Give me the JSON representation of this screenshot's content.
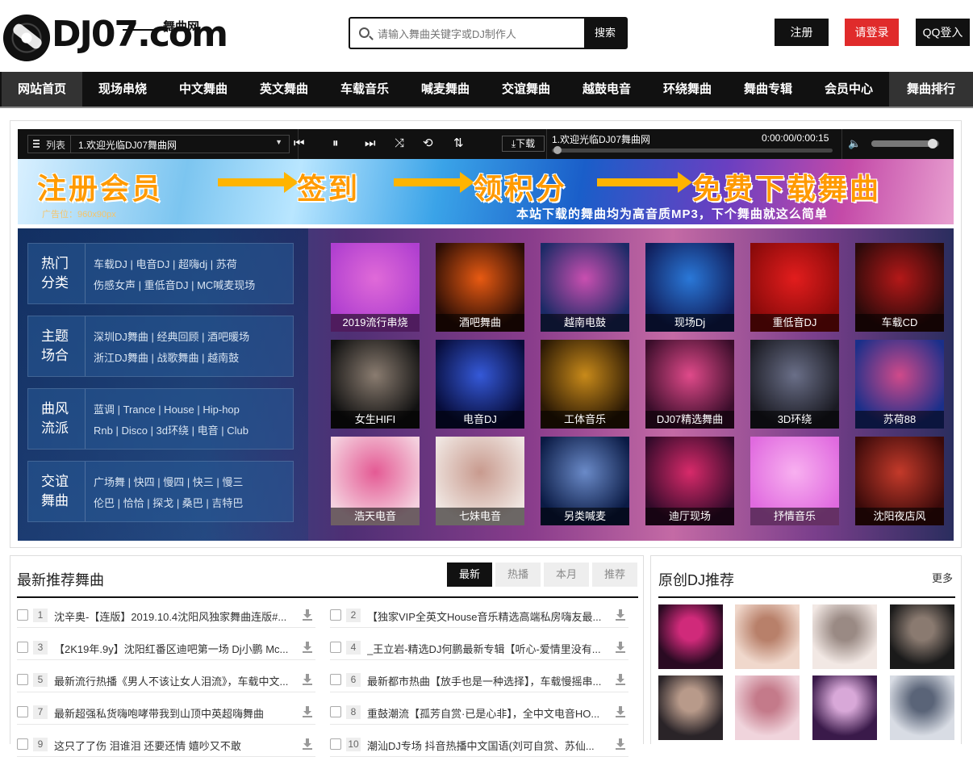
{
  "header": {
    "logo_brand": "DJ07.com",
    "logo_tag": "舞曲网",
    "search_placeholder": "请输入舞曲关键字或DJ制作人",
    "search_button": "搜索",
    "register": "注册",
    "login": "请登录",
    "qq_login": "QQ登入"
  },
  "nav": [
    "网站首页",
    "现场串烧",
    "中文舞曲",
    "英文舞曲",
    "车载音乐",
    "喊麦舞曲",
    "交谊舞曲",
    "越鼓电音",
    "环绕舞曲",
    "舞曲专辑",
    "会员中心",
    "舞曲排行"
  ],
  "player": {
    "list_label": "列表",
    "current_list_track": "1.欢迎光临DJ07舞曲网",
    "download_label": "下载",
    "now_playing": "1.欢迎光临DJ07舞曲网",
    "time": "0:00:00/0:00:15",
    "volume": 0.9,
    "progress": 0.0
  },
  "banner": {
    "step1": "注册会员",
    "step2": "签到",
    "step3": "领积分",
    "step4": "免费下载舞曲",
    "ad_label": "广告位：960x90px",
    "subtitle": "本站下载的舞曲均为高音质MP3，下个舞曲就这么简单"
  },
  "categories": [
    {
      "title": "热门分类",
      "line1": "车载DJ | 电音DJ | 超嗨dj | 苏荷",
      "line2": "伤感女声 | 重低音DJ | MC喊麦现场"
    },
    {
      "title": "主题场合",
      "line1": "深圳DJ舞曲 | 经典回顾 | 酒吧暖场",
      "line2": "浙江DJ舞曲 | 战歌舞曲 | 越南鼓"
    },
    {
      "title": "曲风流派",
      "line1": "蓝调 | Trance | House | Hip-hop",
      "line2": "Rnb | Disco | 3d环绕 | 电音 | Club"
    },
    {
      "title": "交谊舞曲",
      "line1": "广场舞 | 快四 | 慢四 | 快三 | 慢三",
      "line2": "伦巴 | 恰恰 | 探戈 | 桑巴 | 吉特巴"
    }
  ],
  "tiles": [
    {
      "label": "2019流行串烧",
      "c1": "#b03fd0",
      "c2": "#e06ad8"
    },
    {
      "label": "酒吧舞曲",
      "c1": "#2a0d05",
      "c2": "#e85a12"
    },
    {
      "label": "越南电鼓",
      "c1": "#1b2a66",
      "c2": "#c94fb0"
    },
    {
      "label": "现场Dj",
      "c1": "#101d5a",
      "c2": "#2a78d8"
    },
    {
      "label": "重低音DJ",
      "c1": "#8a0a0a",
      "c2": "#e21d1d"
    },
    {
      "label": "车载CD",
      "c1": "#2a0a0a",
      "c2": "#b41818"
    },
    {
      "label": "女生HIFI",
      "c1": "#111111",
      "c2": "#8a7c70"
    },
    {
      "label": "电音DJ",
      "c1": "#070c3a",
      "c2": "#3559d8"
    },
    {
      "label": "工体音乐",
      "c1": "#2a1804",
      "c2": "#c88a1a"
    },
    {
      "label": "DJ07精选舞曲",
      "c1": "#3a0d2a",
      "c2": "#e04a8a"
    },
    {
      "label": "3D环绕",
      "c1": "#1a1a22",
      "c2": "#6a6f88"
    },
    {
      "label": "苏荷88",
      "c1": "#1a2f8a",
      "c2": "#d04a8a"
    },
    {
      "label": "浩天电音",
      "c1": "#f4d0de",
      "c2": "#e45a94"
    },
    {
      "label": "七妹电音",
      "c1": "#efe5e0",
      "c2": "#c89a8e"
    },
    {
      "label": "另类喊麦",
      "c1": "#0a1a44",
      "c2": "#6a8ac8"
    },
    {
      "label": "迪厅现场",
      "c1": "#330a2a",
      "c2": "#d82a6a"
    },
    {
      "label": "抒情音乐",
      "c1": "#e06adf",
      "c2": "#f8b0f0"
    },
    {
      "label": "沈阳夜店风",
      "c1": "#3a0a0a",
      "c2": "#c43a2a"
    }
  ],
  "latest": {
    "title": "最新推荐舞曲",
    "tabs": [
      "最新",
      "热播",
      "本月",
      "推荐"
    ],
    "songs": [
      {
        "no": "1",
        "title": "沈辛奥-【连版】2019.10.4沈阳风独家舞曲连版#..."
      },
      {
        "no": "2",
        "title": "【独家VIP全英文House音乐精选高端私房嗨友最..."
      },
      {
        "no": "3",
        "title": "【2K19年.9y】沈阳红番区迪吧第一场 Dj小鹏 Mc..."
      },
      {
        "no": "4",
        "title": "_王立岩-精选DJ何鹏最新专辑【听心-爱情里没有..."
      },
      {
        "no": "5",
        "title": "最新流行热播《男人不该让女人泪流》，车载中文..."
      },
      {
        "no": "6",
        "title": "最新都市热曲【放手也是一种选择】，车载慢摇串..."
      },
      {
        "no": "7",
        "title": "最新超强私货嗨咆哮带我到山顶中英超嗨舞曲"
      },
      {
        "no": "8",
        "title": "重鼓潮流【孤芳自赏·已是心非】，全中文电音HO..."
      },
      {
        "no": "9",
        "title": "这只了了伤 泪谁泪 还要还情 嬉吵又不敢"
      },
      {
        "no": "10",
        "title": "潮汕DJ专场 抖音热播中文国语(刘可自赏、苏仙..."
      }
    ]
  },
  "djs": {
    "title": "原创DJ推荐",
    "more": "更多",
    "avatars": [
      {
        "c1": "#2a0a22",
        "c2": "#d02a7a"
      },
      {
        "c1": "#f0d8cc",
        "c2": "#b8806a"
      },
      {
        "c1": "#f2e8e4",
        "c2": "#9a8a84"
      },
      {
        "c1": "#1a1a1a",
        "c2": "#8a7a70"
      },
      {
        "c1": "#2a2428",
        "c2": "#b89a8a"
      },
      {
        "c1": "#f0d4dc",
        "c2": "#c47a8a"
      },
      {
        "c1": "#3a1a4a",
        "c2": "#d8a8d8"
      },
      {
        "c1": "#d8dce4",
        "c2": "#5a6478"
      }
    ]
  }
}
